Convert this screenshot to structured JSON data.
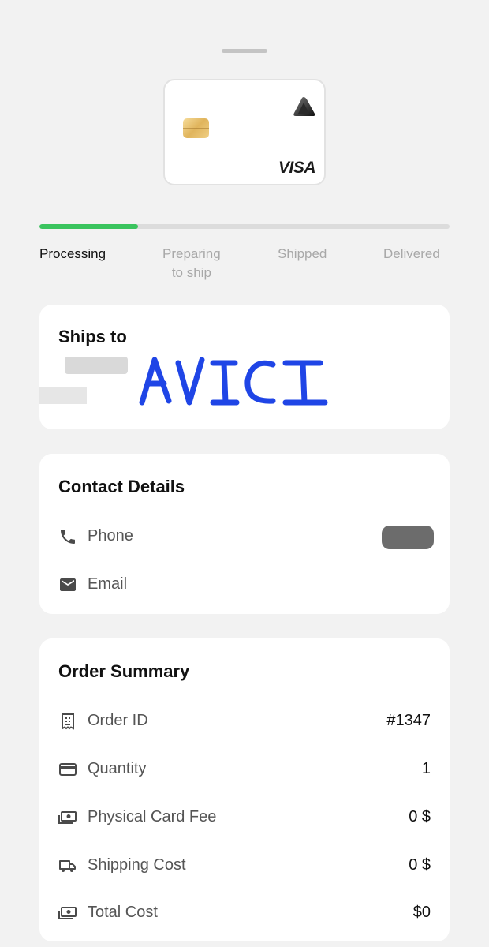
{
  "card": {
    "network": "VISA"
  },
  "progress": {
    "fraction": 0.24,
    "steps": [
      {
        "label": "Processing",
        "active": true
      },
      {
        "label": "Preparing",
        "label2": "to ship",
        "active": false
      },
      {
        "label": "Shipped",
        "active": false
      },
      {
        "label": "Delivered",
        "active": false
      }
    ]
  },
  "ships_to": {
    "title": "Ships to",
    "handwritten_name": "AVICI"
  },
  "contact": {
    "title": "Contact Details",
    "phone_label": "Phone",
    "email_label": "Email"
  },
  "order_summary": {
    "title": "Order Summary",
    "rows": [
      {
        "icon": "receipt-icon",
        "label": "Order ID",
        "value": "#1347"
      },
      {
        "icon": "card-icon",
        "label": "Quantity",
        "value": "1"
      },
      {
        "icon": "cash-icon",
        "label": "Physical Card Fee",
        "value": "0 $"
      },
      {
        "icon": "truck-icon",
        "label": "Shipping Cost",
        "value": "0 $"
      },
      {
        "icon": "cash-icon",
        "label": "Total Cost",
        "value": "$0"
      }
    ]
  },
  "colors": {
    "accent": "#3ac45e",
    "background": "#f2f2f2",
    "handwriting": "#1f45e6"
  }
}
